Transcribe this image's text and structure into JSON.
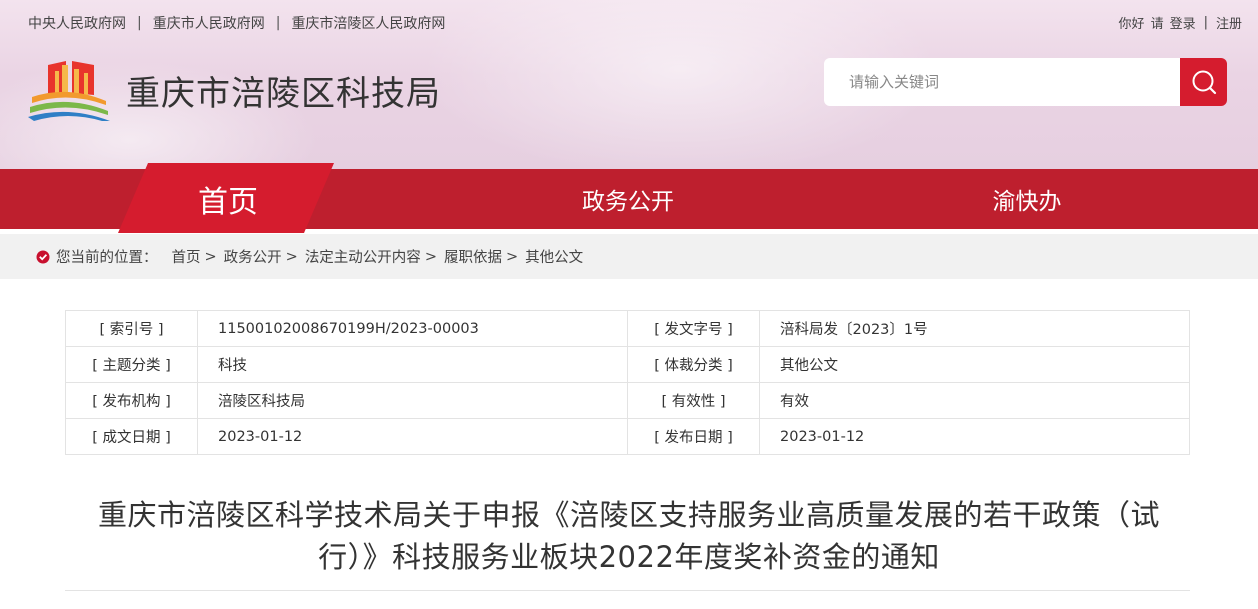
{
  "top_links": [
    "中央人民政府网",
    "重庆市人民政府网",
    "重庆市涪陵区人民政府网"
  ],
  "user": {
    "greeting": "你好",
    "please": "请",
    "login": "登录",
    "register": "注册"
  },
  "site": {
    "title": "重庆市涪陵区科技局"
  },
  "search": {
    "placeholder": "请输入关键词",
    "icon": "search-icon"
  },
  "nav": {
    "home": "首页",
    "gov_affairs": "政务公开",
    "yu_kuai_ban": "渝快办"
  },
  "breadcrumb": {
    "label": "您当前的位置：",
    "items": [
      "首页",
      "政务公开",
      "法定主动公开内容",
      "履职依据",
      "其他公文"
    ],
    "separator": ">"
  },
  "meta_table": {
    "rows": [
      {
        "k1": "[ 索引号 ]",
        "v1": "11500102008670199H/2023-00003",
        "k2": "[ 发文字号 ]",
        "v2": "涪科局发〔2023〕1号"
      },
      {
        "k1": "[ 主题分类 ]",
        "v1": "科技",
        "k2": "[ 体裁分类 ]",
        "v2": "其他公文"
      },
      {
        "k1": "[ 发布机构 ]",
        "v1": "涪陵区科技局",
        "k2": "[ 有效性 ]",
        "v2": "有效"
      },
      {
        "k1": "[ 成文日期 ]",
        "v1": "2023-01-12",
        "k2": "[ 发布日期 ]",
        "v2": "2023-01-12"
      }
    ]
  },
  "document": {
    "title_line1": "重庆市涪陵区科学技术局关于申报《涪陵区支持服务业高质量发展的若干政策（试",
    "title_line2": "行）》科技服务业板块2022年度奖补资金的通知"
  },
  "colors": {
    "brand_red": "#be1f2e",
    "search_red": "#d51c2e",
    "home_red": "#d51c2e"
  }
}
